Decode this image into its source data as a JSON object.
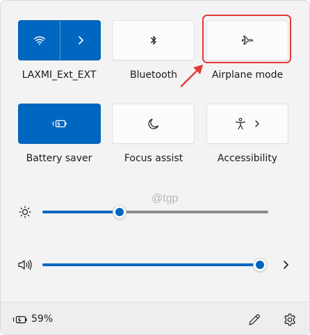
{
  "quick_settings": {
    "tiles": {
      "wifi": {
        "label": "LAXMI_Ext_EXT",
        "state": "on",
        "icon_left": "wifi-icon",
        "icon_right": "chevron-right-icon"
      },
      "bluetooth": {
        "label": "Bluetooth",
        "state": "off",
        "icon": "bluetooth-icon"
      },
      "airplane_mode": {
        "label": "Airplane mode",
        "state": "off",
        "icon": "airplane-icon",
        "highlighted": true
      },
      "battery_saver": {
        "label": "Battery saver",
        "state": "on",
        "icon": "battery-saver-icon"
      },
      "focus_assist": {
        "label": "Focus assist",
        "state": "off",
        "icon": "moon-icon"
      },
      "accessibility": {
        "label": "Accessibility",
        "state": "off",
        "icon": "accessibility-icon",
        "icon_right": "chevron-right-icon"
      }
    },
    "sliders": {
      "brightness": {
        "icon": "sun-icon",
        "value_percent": 34
      },
      "volume": {
        "icon": "speaker-icon",
        "value_percent": 100,
        "icon_right": "chevron-right-icon"
      }
    }
  },
  "watermark": "@tgp",
  "footer": {
    "battery_percent": "59%",
    "battery_icon": "battery-charging-icon",
    "edit_icon": "pencil-icon",
    "settings_icon": "gear-icon"
  },
  "colors": {
    "accent": "#0067c0",
    "highlight": "#e53935",
    "panel_bg": "#f3f3f3"
  }
}
